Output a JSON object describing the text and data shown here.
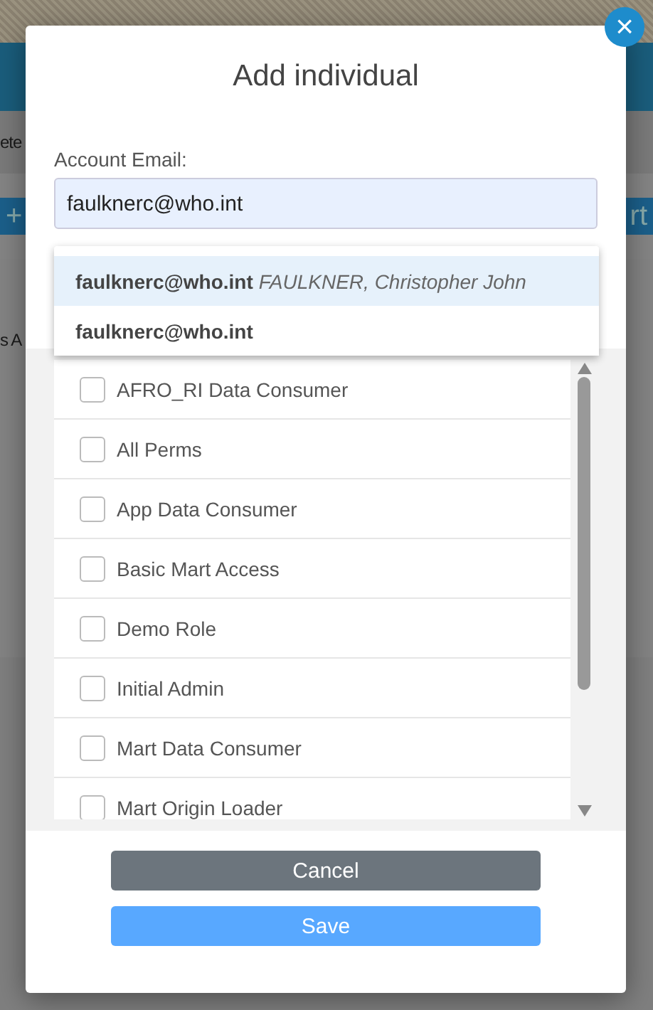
{
  "background_page": {
    "fragments": [
      {
        "kind": "text",
        "text": "ete"
      },
      {
        "kind": "button",
        "text": "+"
      },
      {
        "kind": "button",
        "text": "rt"
      },
      {
        "kind": "text",
        "text": "s A"
      }
    ]
  },
  "dialog": {
    "title": "Add individual",
    "close_label": "×",
    "email": {
      "label": "Account Email:",
      "value": "faulknerc@who.int"
    },
    "suggestions": [
      {
        "email": "faulknerc@who.int",
        "name": "FAULKNER, Christopher John",
        "selected": true
      },
      {
        "email": "faulknerc@who.int",
        "selected": false
      }
    ],
    "roles": [
      {
        "label": "AFRO_RI Data Consumer",
        "checked": false
      },
      {
        "label": "All Perms",
        "checked": false
      },
      {
        "label": "App Data Consumer",
        "checked": false
      },
      {
        "label": "Basic Mart Access",
        "checked": false
      },
      {
        "label": "Demo Role",
        "checked": false
      },
      {
        "label": "Initial Admin",
        "checked": false
      },
      {
        "label": "Mart Data Consumer",
        "checked": false
      },
      {
        "label": "Mart Origin Loader",
        "checked": false
      }
    ],
    "buttons": [
      {
        "kind": "secondary",
        "label": "Cancel"
      },
      {
        "kind": "primary",
        "label": "Save"
      }
    ]
  }
}
